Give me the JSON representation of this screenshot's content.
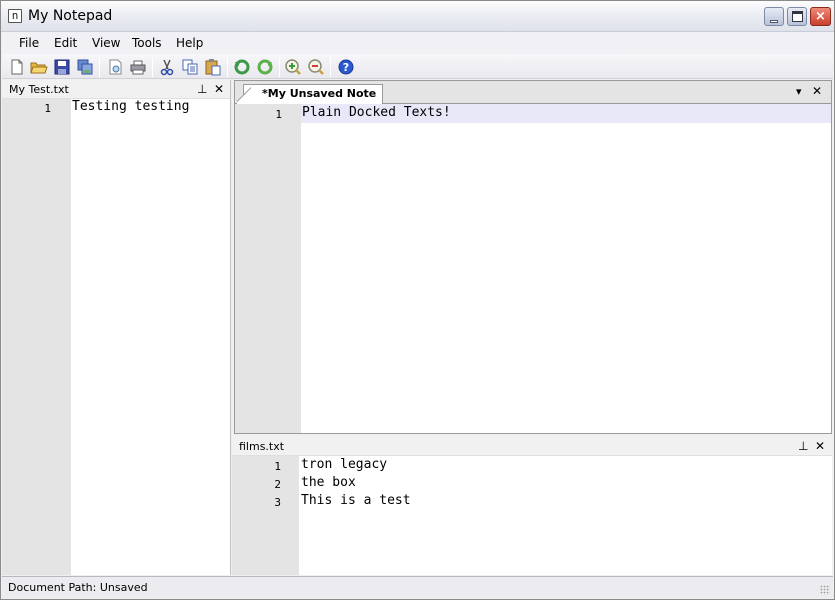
{
  "window": {
    "title": "My Notepad",
    "app_icon_letter": "n",
    "controls": {
      "minimize": "minimize",
      "maximize": "maximize",
      "close": "×"
    }
  },
  "menu": {
    "items": [
      {
        "label": "File"
      },
      {
        "label": "Edit"
      },
      {
        "label": "View"
      },
      {
        "label": "Tools"
      },
      {
        "label": "Help"
      }
    ]
  },
  "toolbar": {
    "buttons": [
      {
        "name": "new-file",
        "icon": "new-file-icon"
      },
      {
        "name": "open",
        "icon": "open-folder-icon"
      },
      {
        "name": "save",
        "icon": "save-icon"
      },
      {
        "name": "save-all",
        "icon": "save-all-icon"
      },
      {
        "name": "print-preview",
        "icon": "print-preview-icon"
      },
      {
        "name": "print",
        "icon": "printer-icon"
      },
      {
        "name": "cut",
        "icon": "scissors-icon"
      },
      {
        "name": "copy",
        "icon": "copy-icon"
      },
      {
        "name": "paste",
        "icon": "paste-icon"
      },
      {
        "name": "undo",
        "icon": "undo-icon"
      },
      {
        "name": "redo",
        "icon": "redo-icon"
      },
      {
        "name": "zoom-in",
        "icon": "zoom-in-icon"
      },
      {
        "name": "zoom-out",
        "icon": "zoom-out-icon"
      },
      {
        "name": "help",
        "icon": "help-icon"
      }
    ]
  },
  "left_panel": {
    "title": "My Test.txt",
    "pin_glyph": "⊥",
    "close_glyph": "✕",
    "lines": [
      {
        "number": "1",
        "text": "Testing testing"
      }
    ]
  },
  "document": {
    "tab_label": "*My Unsaved Note",
    "dropdown_glyph": "▾",
    "close_glyph": "✕",
    "lines": [
      {
        "number": "1",
        "text": "Plain Docked Texts!"
      }
    ]
  },
  "bottom_panel": {
    "title": "films.txt",
    "pin_glyph": "⊥",
    "close_glyph": "✕",
    "lines": [
      {
        "number": "1",
        "text": "tron legacy"
      },
      {
        "number": "2",
        "text": "the box"
      },
      {
        "number": "3",
        "text": "This is a test"
      }
    ]
  },
  "status": {
    "text": "Document Path: Unsaved"
  }
}
